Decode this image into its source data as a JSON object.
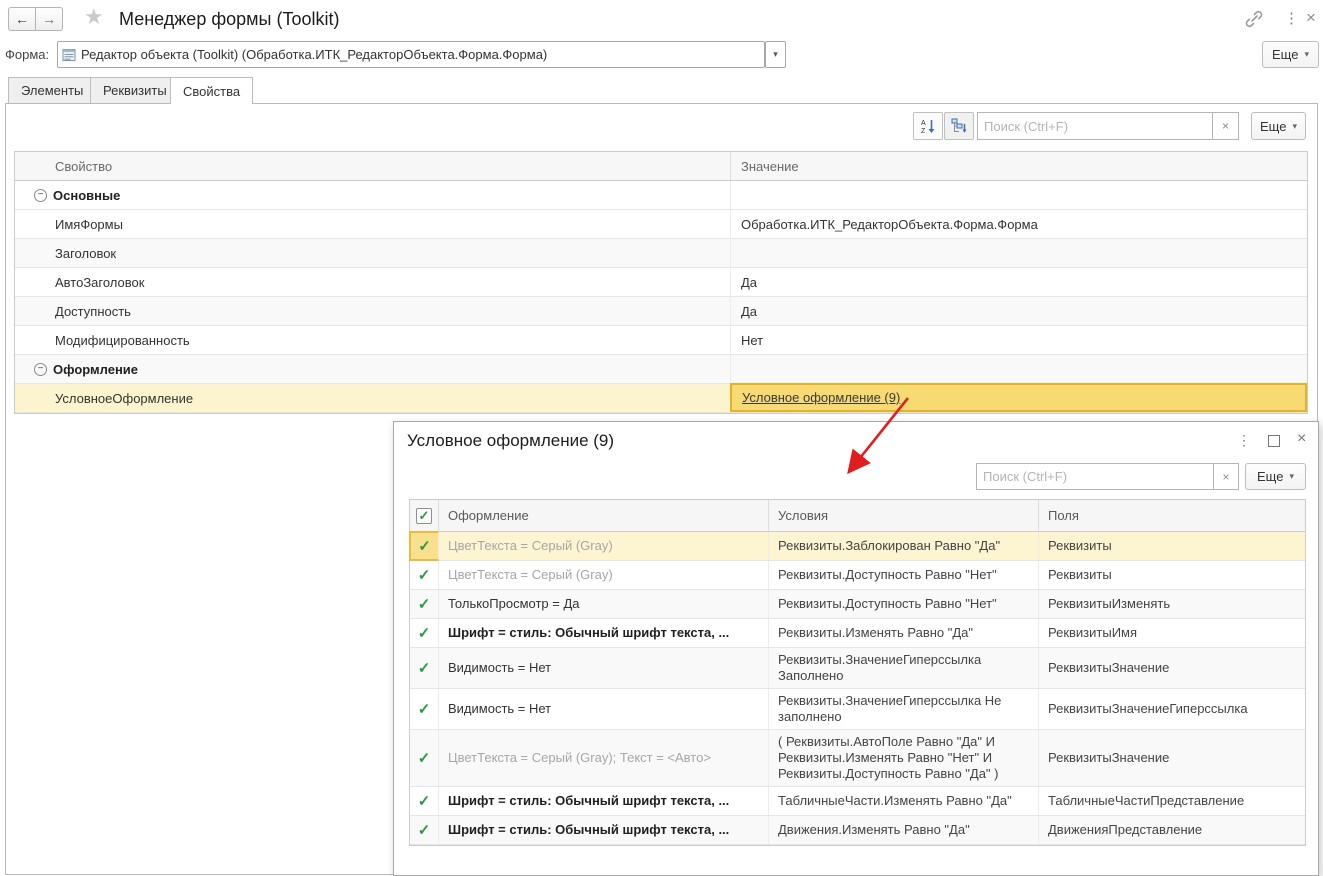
{
  "colors": {
    "selection_row_yellow": "#fcf3cf",
    "selection_cell_gold": "#f7da71",
    "selection_border_gold": "#e2b329",
    "check_green": "#2a9940",
    "arrow_red": "#e01e1e",
    "gray_styled_text": "#a6a6a6"
  },
  "icons": {
    "back": "←",
    "forward": "→",
    "star": "★",
    "kebab": "⋮",
    "close": "×",
    "caret": "▾",
    "check": "✓",
    "collapse": "−",
    "clear": "×"
  },
  "header": {
    "title": "Менеджер формы (Toolkit)"
  },
  "form_row": {
    "label": "Форма:",
    "value": "Редактор объекта (Toolkit) (Обработка.ИТК_РедакторОбъекта.Форма.Форма)",
    "more_label": "Еще"
  },
  "tabs": [
    {
      "label": "Элементы",
      "active": false
    },
    {
      "label": "Реквизиты",
      "active": false
    },
    {
      "label": "Свойства",
      "active": true
    }
  ],
  "toolbar": {
    "search_placeholder": "Поиск (Ctrl+F)",
    "more_label": "Еще"
  },
  "properties_table": {
    "columns": [
      "Свойство",
      "Значение"
    ],
    "rows": [
      {
        "type": "group",
        "name": "Основные",
        "shade": false
      },
      {
        "type": "prop",
        "name": "ИмяФормы",
        "value": "Обработка.ИТК_РедакторОбъекта.Форма.Форма",
        "shade": false
      },
      {
        "type": "prop",
        "name": "Заголовок",
        "value": "",
        "shade": true
      },
      {
        "type": "prop",
        "name": "АвтоЗаголовок",
        "value": "Да",
        "shade": false
      },
      {
        "type": "prop",
        "name": "Доступность",
        "value": "Да",
        "shade": true
      },
      {
        "type": "prop",
        "name": "Модифицированность",
        "value": "Нет",
        "shade": false
      },
      {
        "type": "group",
        "name": "Оформление",
        "shade": true
      },
      {
        "type": "prop",
        "name": "УсловноеОформление",
        "value": "Условное оформление (9)",
        "link": true,
        "selected": true,
        "shade": false
      }
    ]
  },
  "popup": {
    "title": "Условное оформление (9)",
    "search_placeholder": "Поиск (Ctrl+F)",
    "more_label": "Еще",
    "table": {
      "columns": [
        "Оформление",
        "Условия",
        "Поля"
      ],
      "rows": [
        {
          "appearance": "ЦветТекста = Серый (Gray)",
          "style": "gray",
          "condition": "Реквизиты.Заблокирован Равно \"Да\"",
          "fields": "Реквизиты",
          "checked": true,
          "selected": true,
          "shade": false
        },
        {
          "appearance": "ЦветТекста = Серый (Gray)",
          "style": "gray",
          "condition": "Реквизиты.Доступность Равно \"Нет\"",
          "fields": "Реквизиты",
          "checked": true,
          "shade": false
        },
        {
          "appearance": "ТолькоПросмотр = Да",
          "style": "normal",
          "condition": "Реквизиты.Доступность Равно \"Нет\"",
          "fields": "РеквизитыИзменять",
          "checked": true,
          "shade": true
        },
        {
          "appearance": "Шрифт = стиль: Обычный шрифт текста, ...",
          "style": "bold",
          "condition": "Реквизиты.Изменять Равно \"Да\"",
          "fields": "РеквизитыИмя",
          "checked": true,
          "shade": false
        },
        {
          "appearance": "Видимость = Нет",
          "style": "normal",
          "condition": "Реквизиты.ЗначениеГиперссылка Заполнено",
          "fields": "РеквизитыЗначение",
          "checked": true,
          "shade": true
        },
        {
          "appearance": "Видимость = Нет",
          "style": "normal",
          "condition": "Реквизиты.ЗначениеГиперссылка Не заполнено",
          "fields": "РеквизитыЗначениеГиперссылка",
          "checked": true,
          "shade": false
        },
        {
          "appearance": "ЦветТекста = Серый (Gray); Текст = <Авто>",
          "style": "gray",
          "condition": "( Реквизиты.АвтоПоле Равно \"Да\" И Реквизиты.Изменять Равно \"Нет\" И Реквизиты.Доступность Равно \"Да\" )",
          "fields": "РеквизитыЗначение",
          "checked": true,
          "shade": true
        },
        {
          "appearance": "Шрифт = стиль: Обычный шрифт текста, ...",
          "style": "bold",
          "condition": "ТабличныеЧасти.Изменять Равно \"Да\"",
          "fields": "ТабличныеЧастиПредставление",
          "checked": true,
          "shade": false
        },
        {
          "appearance": "Шрифт = стиль: Обычный шрифт текста, ...",
          "style": "bold",
          "condition": "Движения.Изменять Равно \"Да\"",
          "fields": "ДвиженияПредставление",
          "checked": true,
          "shade": true
        }
      ]
    }
  }
}
